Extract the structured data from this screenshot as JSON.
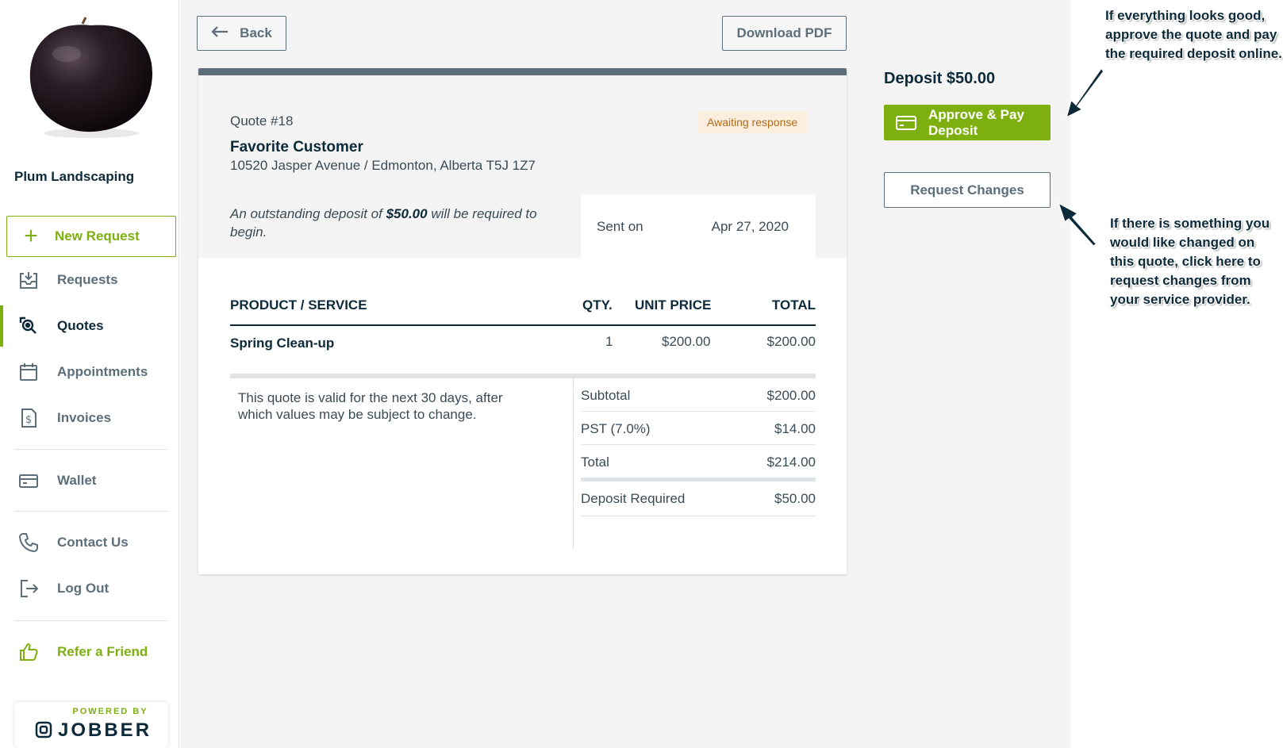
{
  "sidebar": {
    "company_name": "Plum Landscaping",
    "new_request_label": "New Request",
    "items": [
      {
        "label": "Requests",
        "icon": "inbox-download-icon"
      },
      {
        "label": "Quotes",
        "icon": "quote-search-icon"
      },
      {
        "label": "Appointments",
        "icon": "calendar-icon"
      },
      {
        "label": "Invoices",
        "icon": "dollar-document-icon"
      },
      {
        "label": "Wallet",
        "icon": "credit-card-icon"
      },
      {
        "label": "Contact Us",
        "icon": "phone-icon"
      },
      {
        "label": "Log Out",
        "icon": "logout-icon"
      },
      {
        "label": "Refer a Friend",
        "icon": "thumbs-up-icon"
      }
    ],
    "powered_by": "POWERED BY",
    "brand": "JOBBER"
  },
  "toolbar": {
    "back_label": "Back",
    "download_label": "Download PDF"
  },
  "quote": {
    "number": "Quote #18",
    "status": "Awaiting response",
    "customer_name": "Favorite Customer",
    "address": "10520 Jasper Avenue / Edmonton, Alberta T5J 1Z7",
    "deposit_note_pre": "An outstanding deposit of ",
    "deposit_note_amount": "$50.00",
    "deposit_note_post": " will be required to begin.",
    "sent_label": "Sent on",
    "sent_date": "Apr 27, 2020"
  },
  "table": {
    "headers": [
      "PRODUCT / SERVICE",
      "QTY.",
      "UNIT PRICE",
      "TOTAL"
    ],
    "rows": [
      {
        "product": "Spring Clean-up",
        "qty": "1",
        "unit_price": "$200.00",
        "total": "$200.00"
      }
    ]
  },
  "validity_note": "This quote is valid for the next 30 days, after which values may be subject to change.",
  "summary": [
    {
      "label": "Subtotal",
      "value": "$200.00"
    },
    {
      "label": "PST (7.0%)",
      "value": "$14.00"
    },
    {
      "label": "Total",
      "value": "$214.00"
    },
    {
      "label": "Deposit Required",
      "value": "$50.00"
    }
  ],
  "actions": {
    "deposit_title": "Deposit $50.00",
    "approve_label": "Approve & Pay Deposit",
    "changes_label": "Request Changes"
  },
  "annotations": {
    "approve_hint": "If everything looks good, approve the quote and pay the required deposit online.",
    "changes_hint": "If there is something you would like changed on this quote, click here to request changes from your service provider."
  },
  "colors": {
    "accent_green": "#7db00e",
    "navy": "#0d2a3a",
    "slate": "#5c6e7a",
    "badge_bg": "#fbeede",
    "badge_text": "#b56a15"
  }
}
